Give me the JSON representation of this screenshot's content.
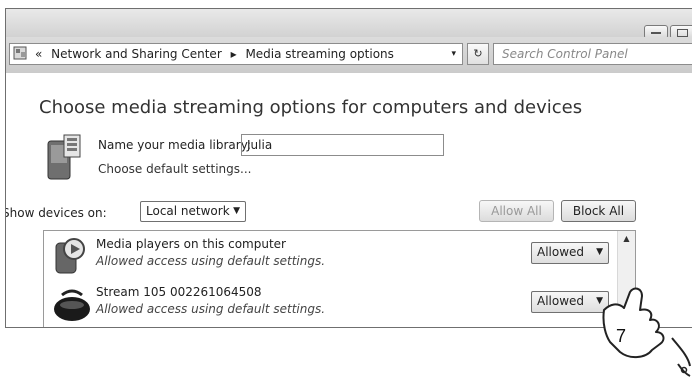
{
  "address": {
    "crumbs": [
      "«",
      "Network and Sharing Center",
      "▸",
      "Media streaming options"
    ],
    "dropdown_glyph": "▾",
    "refresh_glyph": "↻",
    "search_placeholder": "Search Control Panel"
  },
  "page": {
    "heading": "Choose media streaming options for computers and devices",
    "library_label": "Name your media library:",
    "library_value": "Julia",
    "default_settings_link": "Choose default settings...",
    "show_devices_label": "Show devices on:",
    "network_select": "Local network",
    "allow_all": "Allow All",
    "block_all": "Block All"
  },
  "devices": [
    {
      "name": "Media players on this computer",
      "status": "Allowed access using default settings.",
      "access": "Allowed",
      "icon": "media-player-icon"
    },
    {
      "name": "Stream 105 002261064508",
      "status": "Allowed access using default settings.",
      "access": "Allowed",
      "icon": "radio-device-icon"
    }
  ],
  "select_arrow": "▼",
  "scroll_up_glyph": "▲",
  "callout": {
    "step": "7"
  }
}
